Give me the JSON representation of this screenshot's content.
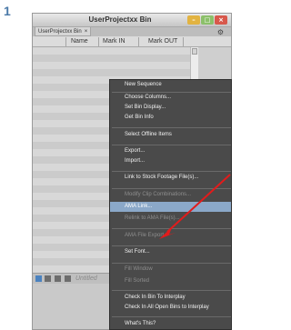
{
  "step_number": "1",
  "window": {
    "title": "UserProjectxx Bin",
    "tab_label": "UserProjectxx Bin",
    "tab_close": "×"
  },
  "columns": {
    "name": "Name",
    "mark_in": "Mark IN",
    "mark_out": "Mark OUT"
  },
  "bin_view": "Untitled",
  "menu": {
    "items": [
      {
        "label": "New Sequence",
        "enabled": true
      },
      {
        "label": "Choose Columns...",
        "enabled": true
      },
      {
        "label": "Set Bin Display...",
        "enabled": true
      },
      {
        "label": "Get Bin Info",
        "enabled": true
      },
      {
        "label": "Select Offline Items",
        "enabled": true
      },
      {
        "label": "Export...",
        "enabled": true
      },
      {
        "label": "Import...",
        "enabled": true
      },
      {
        "label": "Link to Stock Footage File(s)...",
        "enabled": true
      },
      {
        "label": "Modify Clip Combinations...",
        "enabled": false
      },
      {
        "label": "AMA Link...",
        "enabled": true,
        "highlighted": true
      },
      {
        "label": "Relink to AMA File(s)...",
        "enabled": false
      },
      {
        "label": "AMA File Export",
        "enabled": false
      },
      {
        "label": "Set Font...",
        "enabled": true
      },
      {
        "label": "Fill Window",
        "enabled": false
      },
      {
        "label": "Fill Sorted",
        "enabled": false
      },
      {
        "label": "Check In Bin To Interplay",
        "enabled": true
      },
      {
        "label": "Check In All Open Bins to Interplay",
        "enabled": true
      },
      {
        "label": "What's This?",
        "enabled": true
      }
    ]
  },
  "colors": {
    "accent": "#4a79a8",
    "menu_bg": "#4a4a4a",
    "menu_highlight": "#8ba8c9",
    "arrow": "#e21b1b"
  },
  "icons": {
    "minimize": "minimize-icon",
    "maximize": "maximize-icon",
    "close": "close-icon",
    "bin_options": "gear-icon",
    "arrow": "red-arrow-icon"
  }
}
